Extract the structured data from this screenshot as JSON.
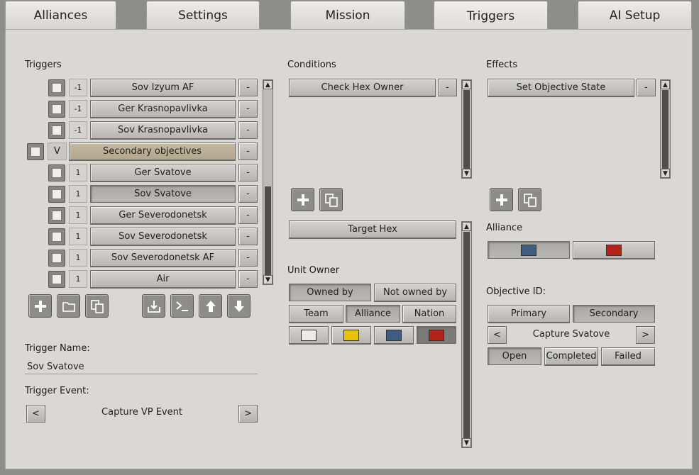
{
  "tabs": [
    "Alliances",
    "Settings",
    "Mission",
    "Triggers",
    "AI Setup"
  ],
  "active_tab": "Triggers",
  "triggers": {
    "label": "Triggers",
    "minus_label": "-",
    "items": [
      {
        "num": "-1",
        "name": "Sov Izyum AF"
      },
      {
        "num": "-1",
        "name": "Ger Krasnopavlivka"
      },
      {
        "num": "-1",
        "name": "Sov Krasnopavlivka"
      },
      {
        "num": "V",
        "name": "Secondary objectives"
      },
      {
        "num": "1",
        "name": "Ger Svatove"
      },
      {
        "num": "1",
        "name": "Sov Svatove"
      },
      {
        "num": "1",
        "name": "Ger Severodonetsk"
      },
      {
        "num": "1",
        "name": "Sov Severodonetsk"
      },
      {
        "num": "1",
        "name": "Sov Severodonetsk AF"
      },
      {
        "num": "1",
        "name": "Air"
      }
    ]
  },
  "trigger_name": {
    "label": "Trigger Name:",
    "value": "Sov Svatove"
  },
  "trigger_event": {
    "label": "Trigger Event:",
    "prev": "<",
    "value": "Capture VP Event",
    "next": ">"
  },
  "conditions": {
    "label": "Conditions",
    "items": [
      "Check Hex Owner"
    ],
    "minus_label": "-",
    "target_hex": "Target Hex",
    "unit_owner_label": "Unit Owner",
    "owned_by": "Owned by",
    "not_owned_by": "Not owned by",
    "team": "Team",
    "alliance": "Alliance",
    "nation": "Nation",
    "swatch_colors": [
      "#ecebe7",
      "#e8c30c",
      "#3f5d80",
      "#b32317"
    ]
  },
  "effects": {
    "label": "Effects",
    "items": [
      "Set Objective State"
    ],
    "minus_label": "-",
    "alliance_label": "Alliance",
    "alliance_colors": [
      "#3f5d80",
      "#b32317"
    ],
    "objective_id_label": "Objective ID:",
    "primary": "Primary",
    "secondary": "Secondary",
    "prev": "<",
    "objective_value": "Capture Svatove",
    "next": ">",
    "open": "Open",
    "completed": "Completed",
    "failed": "Failed"
  },
  "icons": [
    "add-icon",
    "folder-icon",
    "copy-icon",
    "import-icon",
    "console-icon",
    "arrow-up-icon",
    "arrow-down-icon"
  ]
}
